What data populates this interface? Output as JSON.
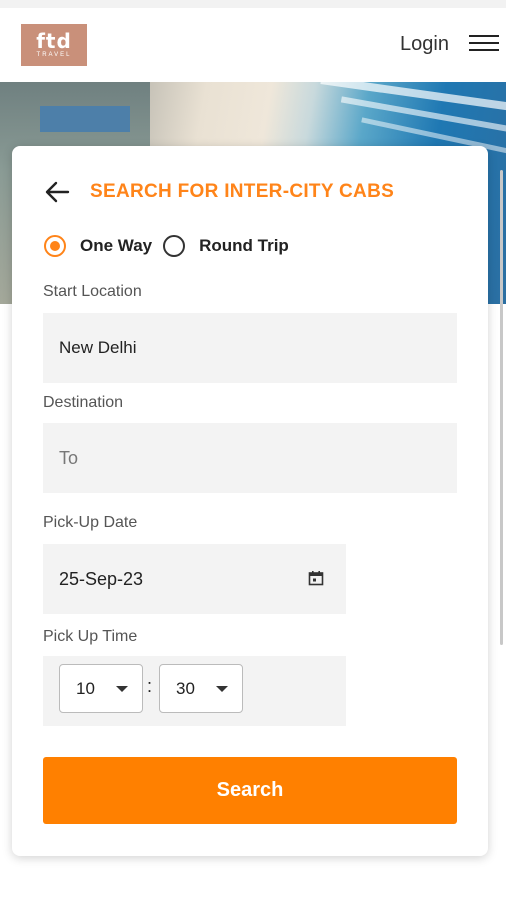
{
  "header": {
    "logo_main": "ftd",
    "logo_sub": "TRAVEL",
    "login_label": "Login"
  },
  "form": {
    "title": "SEARCH FOR INTER-CITY CABS",
    "trip_types": [
      {
        "label": "One Way",
        "selected": true
      },
      {
        "label": "Round Trip",
        "selected": false
      }
    ],
    "start_location": {
      "label": "Start Location",
      "value": "New Delhi"
    },
    "destination": {
      "label": "Destination",
      "placeholder": "To"
    },
    "pickup_date": {
      "label": "Pick-Up Date",
      "value": "25-Sep-23"
    },
    "pickup_time": {
      "label": "Pick Up Time",
      "hour": "10",
      "minute": "30",
      "separator": ":"
    },
    "search_label": "Search"
  },
  "colors": {
    "accent": "#ff8419",
    "button": "#ff8000",
    "logo_bg": "#c9907a"
  }
}
